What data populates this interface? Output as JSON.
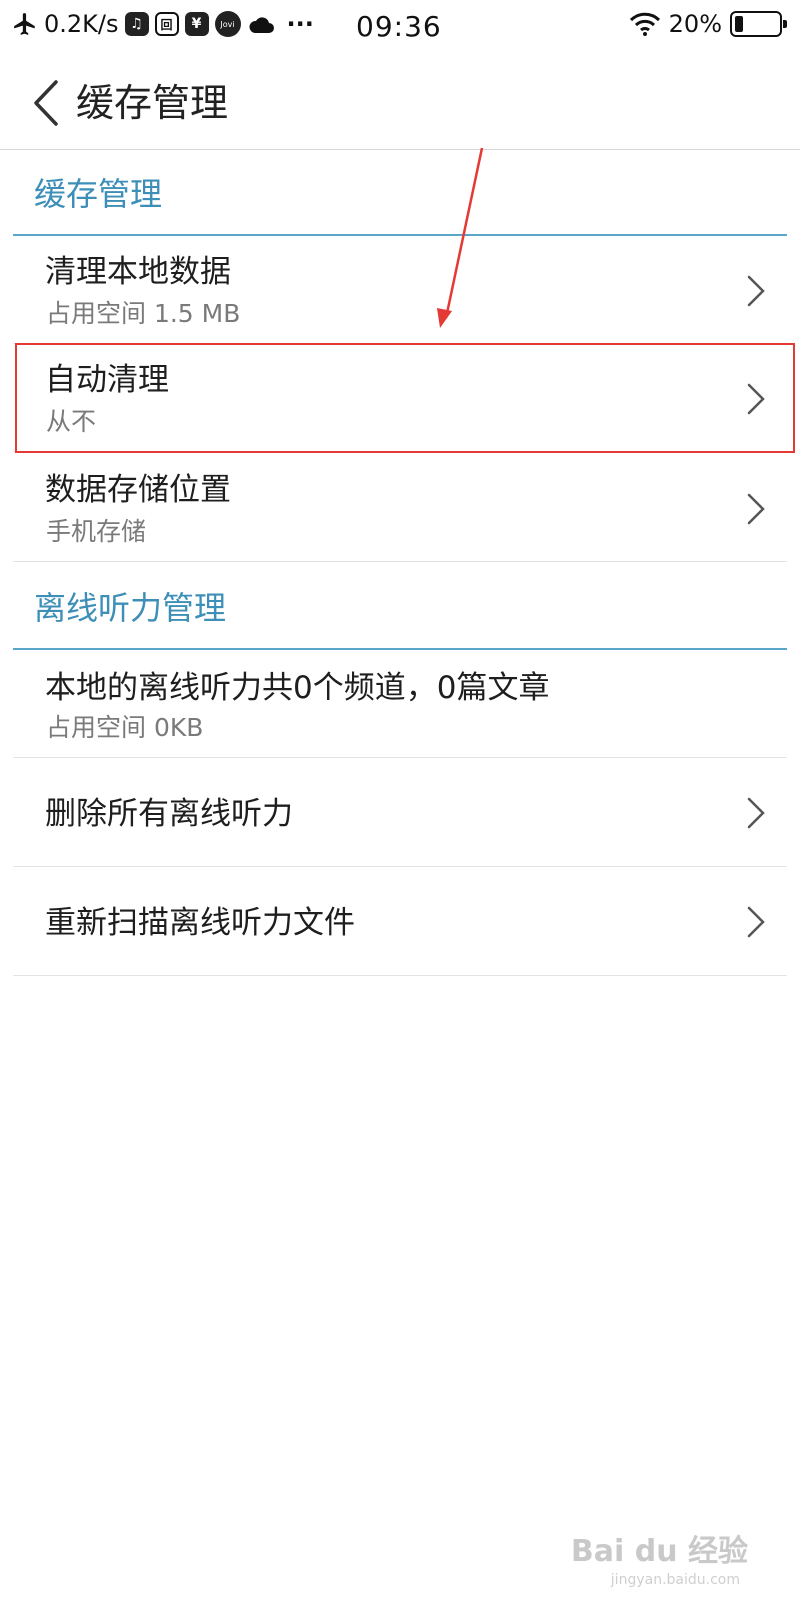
{
  "status_bar": {
    "net_speed": "0.2K/s",
    "time": "09:36",
    "battery_percent": "20%",
    "battery_level": 0.2,
    "more_label": "···",
    "icons": [
      "airplane-icon",
      "music-icon",
      "app-icon",
      "yuan-icon",
      "jovi-icon",
      "cloud-icon",
      "wifi-icon",
      "battery-icon"
    ]
  },
  "header": {
    "title": "缓存管理"
  },
  "sections": [
    {
      "title": "缓存管理",
      "rows": [
        {
          "title": "清理本地数据",
          "subtitle": "占用空间 1.5 MB"
        },
        {
          "title": "自动清理",
          "subtitle": "从不"
        },
        {
          "title": "数据存储位置",
          "subtitle": "手机存储"
        }
      ]
    },
    {
      "title": "离线听力管理",
      "rows": [
        {
          "title": "本地的离线听力共0个频道，0篇文章",
          "subtitle": "占用空间 0KB"
        },
        {
          "title": "删除所有离线听力"
        },
        {
          "title": "重新扫描离线听力文件"
        }
      ]
    }
  ],
  "annotation": {
    "highlight_color": "#e53935",
    "arrow_color": "#e53935"
  },
  "watermark": {
    "brand": "Bai du 经验",
    "url": "jingyan.baidu.com"
  },
  "colors": {
    "section_title": "#3d8fb8",
    "section_divider": "#5aa6c8"
  }
}
